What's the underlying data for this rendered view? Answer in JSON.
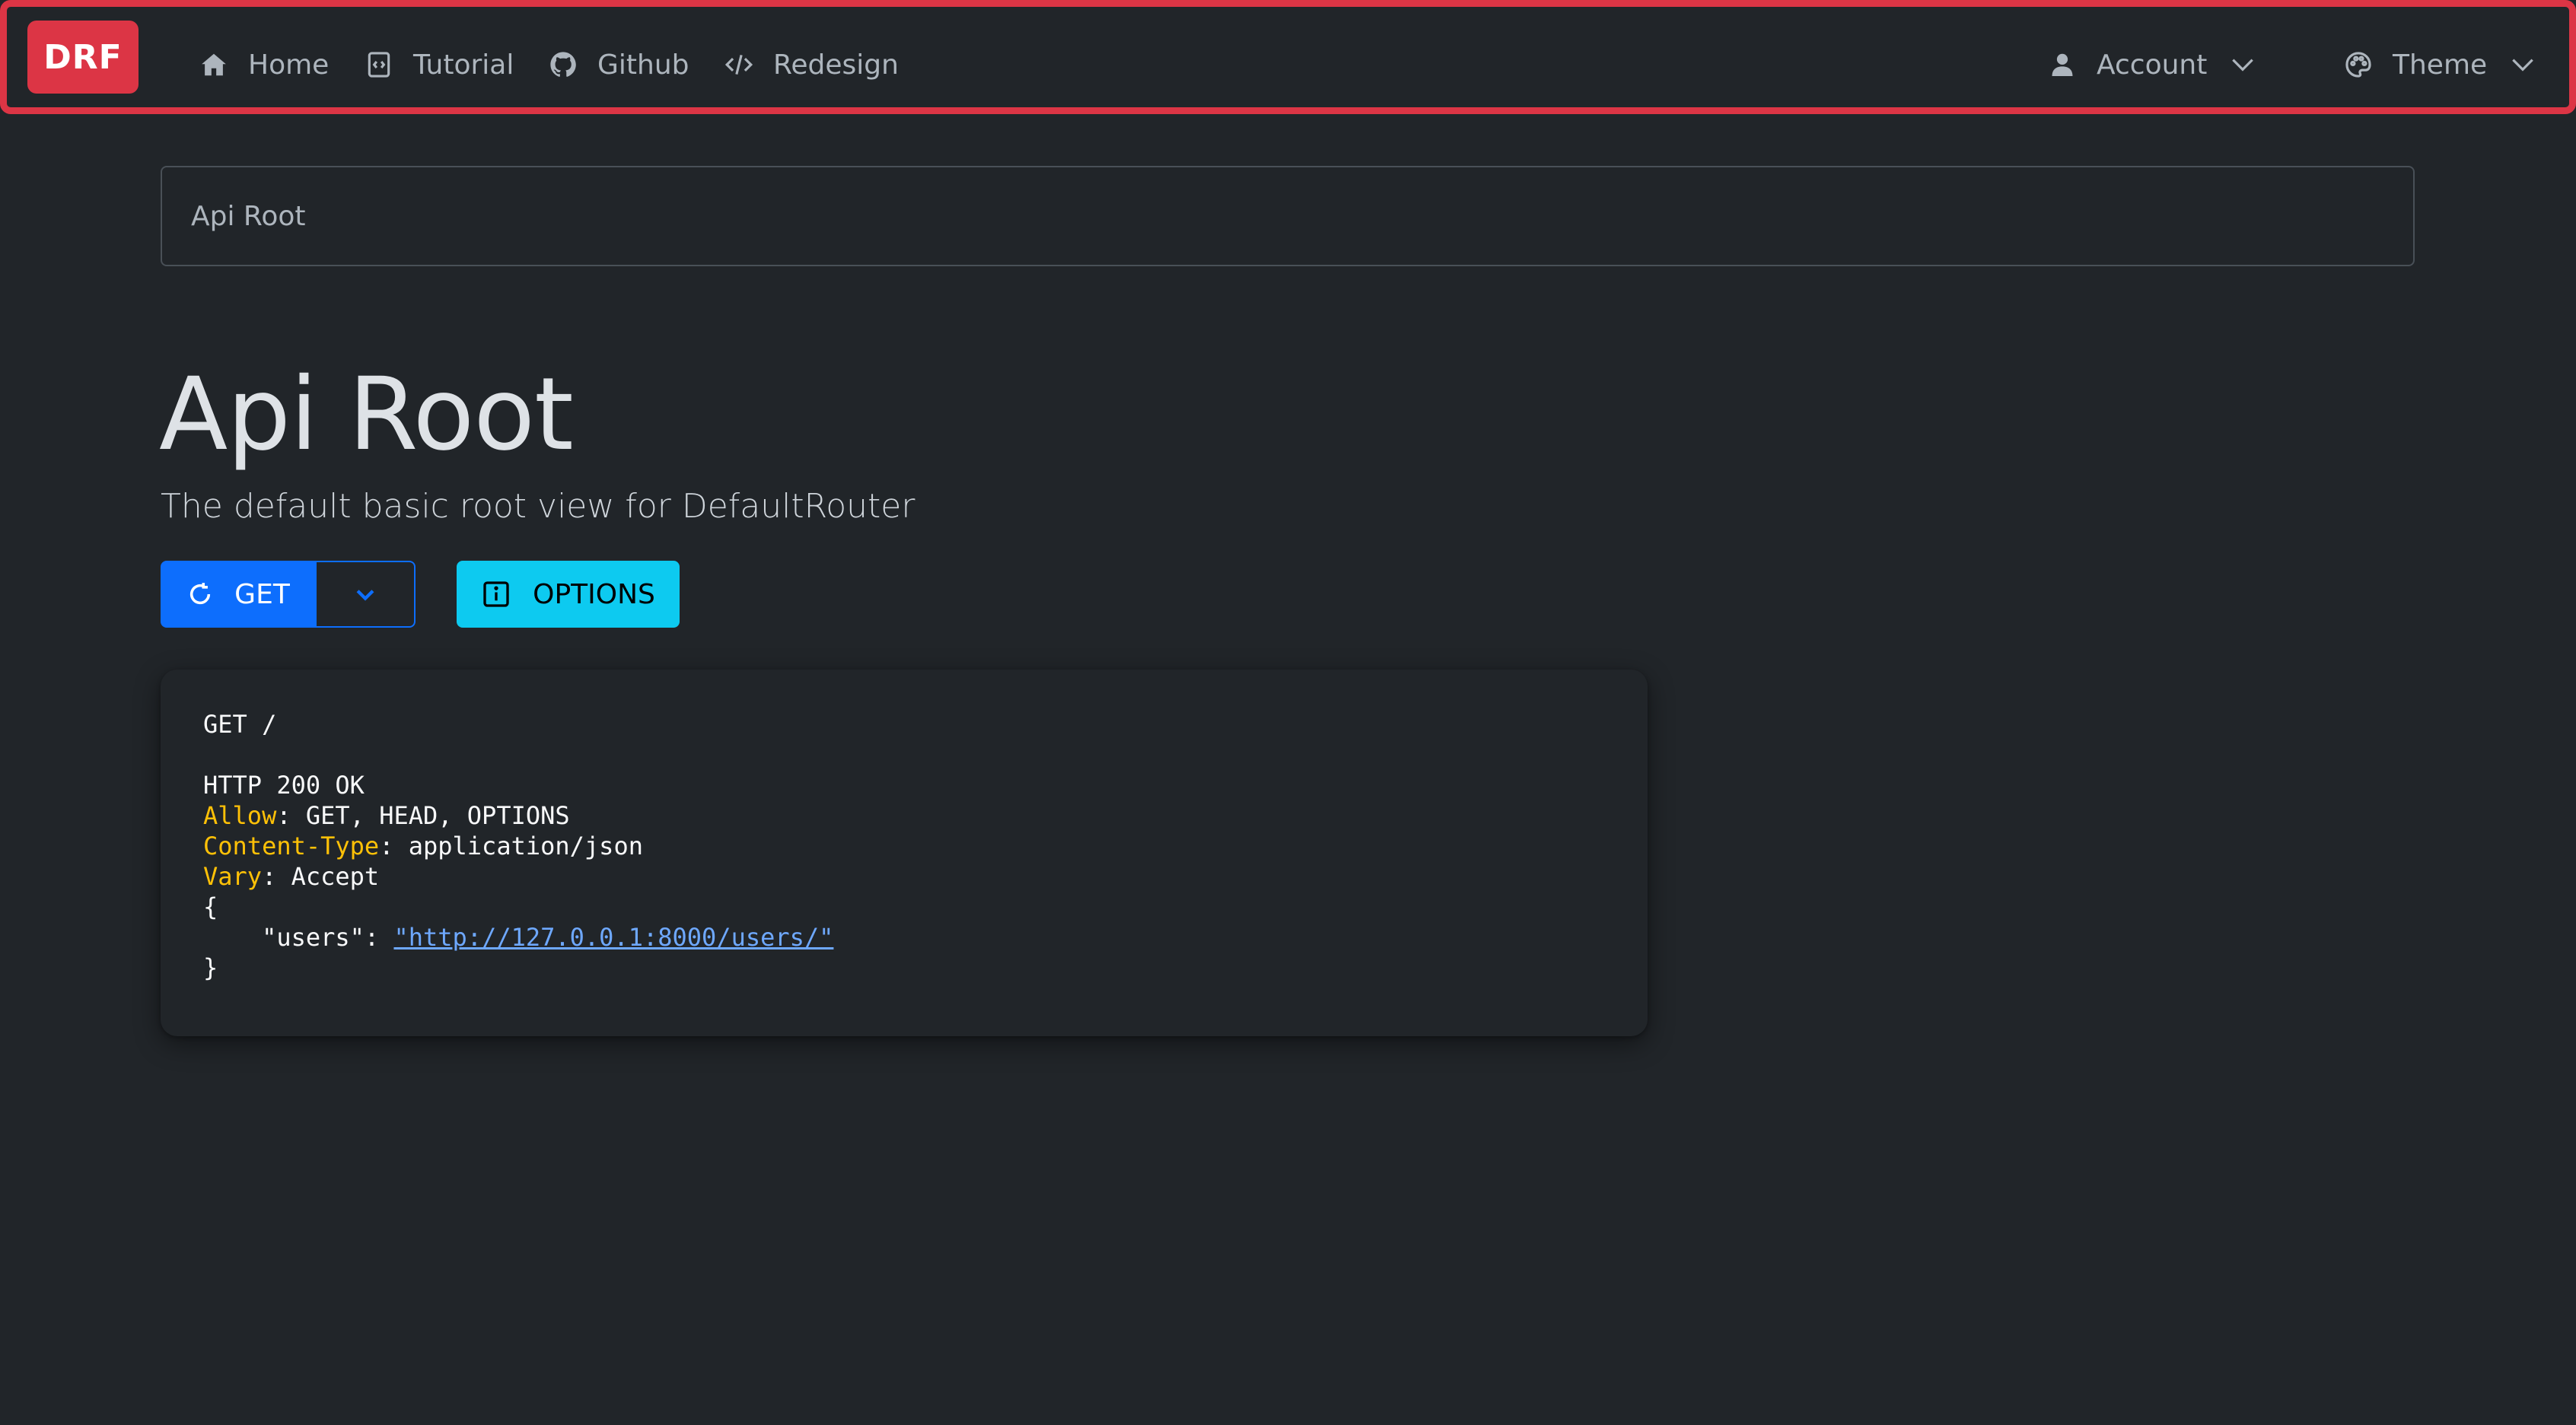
{
  "navbar": {
    "brand": "DRF",
    "items": [
      {
        "label": "Home",
        "icon": "home-icon"
      },
      {
        "label": "Tutorial",
        "icon": "code-file-icon"
      },
      {
        "label": "Github",
        "icon": "github-icon"
      },
      {
        "label": "Redesign",
        "icon": "code-icon"
      }
    ],
    "account_label": "Account",
    "theme_label": "Theme"
  },
  "breadcrumb": {
    "current": "Api Root"
  },
  "header": {
    "title": "Api Root",
    "description": "The default basic root view for DefaultRouter"
  },
  "buttons": {
    "get_label": "GET",
    "options_label": "OPTIONS"
  },
  "response": {
    "request_line": "GET /",
    "status_line": "HTTP 200 OK",
    "headers": [
      {
        "key": "Allow",
        "value": "GET, HEAD, OPTIONS"
      },
      {
        "key": "Content-Type",
        "value": "application/json"
      },
      {
        "key": "Vary",
        "value": "Accept"
      }
    ],
    "open_brace": "{",
    "body_key": "\"users\": ",
    "body_link": "\"http://127.0.0.1:8000/users/\"",
    "close_brace": "}"
  },
  "colors": {
    "accent_red": "#dc3545",
    "primary_blue": "#0d6efd",
    "info_cyan": "#0dcaf0",
    "header_key_yellow": "#ffc107",
    "background": "#212529"
  }
}
